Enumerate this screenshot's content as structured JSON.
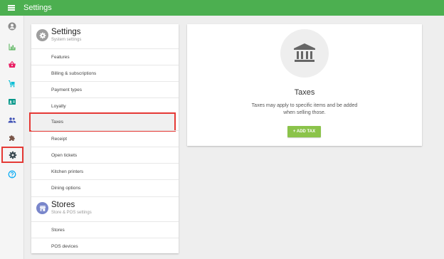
{
  "topbar": {
    "title": "Settings"
  },
  "leftnav": {
    "items": [
      {
        "name": "account-icon",
        "color": "#8c8c8c"
      },
      {
        "name": "reports-icon",
        "color": "#4caf50"
      },
      {
        "name": "items-basket-icon",
        "color": "#e91e63"
      },
      {
        "name": "inventory-cart-icon",
        "color": "#00bcd4"
      },
      {
        "name": "customers-card-icon",
        "color": "#009688"
      },
      {
        "name": "employees-icon",
        "color": "#3f51b5"
      },
      {
        "name": "integrations-puzzle-icon",
        "color": "#795548"
      },
      {
        "name": "settings-gear-icon",
        "color": "#37474f"
      },
      {
        "name": "help-icon",
        "color": "#03a9f4"
      }
    ]
  },
  "settings_section": {
    "title": "Settings",
    "subtitle": "System settings",
    "icon": "gear-icon",
    "icon_bg": "#9e9e9e",
    "items": [
      "Features",
      "Billing & subscriptions",
      "Payment types",
      "Loyalty",
      "Taxes",
      "Receipt",
      "Open tickets",
      "Kitchen printers",
      "Dining options"
    ]
  },
  "stores_section": {
    "title": "Stores",
    "subtitle": "Store & POS settings",
    "icon": "store-icon",
    "icon_bg": "#7986cb",
    "items": [
      "Stores",
      "POS devices"
    ]
  },
  "taxes_panel": {
    "icon": "bank-building-icon",
    "title": "Taxes",
    "description": "Taxes may apply to specific items and be added when selling those.",
    "button_label": "+ ADD TAX"
  },
  "colors": {
    "topbar": "#4caf50",
    "add_button": "#8bc34a",
    "highlight_border": "#e53935"
  }
}
